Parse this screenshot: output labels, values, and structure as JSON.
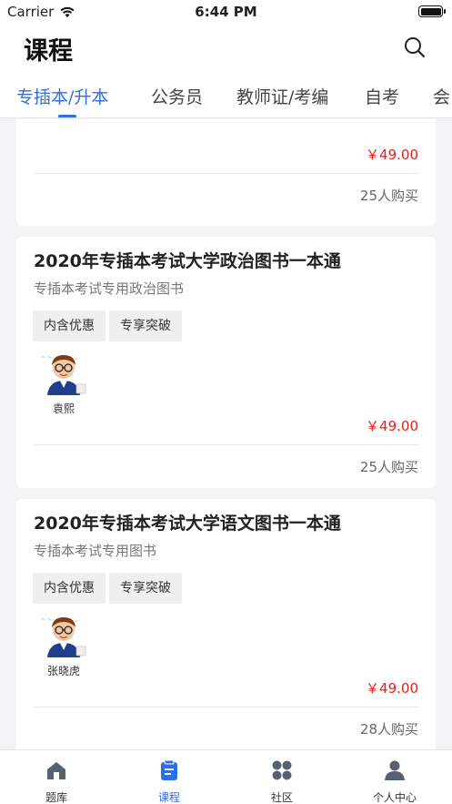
{
  "status_bar": {
    "carrier": "Carrier",
    "time": "6:44 PM"
  },
  "header": {
    "title": "课程"
  },
  "tabs": [
    {
      "label": "专插本/升本",
      "active": true
    },
    {
      "label": "公务员",
      "active": false
    },
    {
      "label": "教师证/考编",
      "active": false
    },
    {
      "label": "自考",
      "active": false
    },
    {
      "label": "会",
      "active": false
    }
  ],
  "courses": [
    {
      "price": "￥49.00",
      "buyers": "25人购买"
    },
    {
      "title": "2020年专插本考试大学政治图书一本通",
      "subtitle": "专插本考试专用政治图书",
      "tags": [
        "内含优惠",
        "专享突破"
      ],
      "teacher": "袁熙",
      "price": "￥49.00",
      "buyers": "25人购买"
    },
    {
      "title": "2020年专插本考试大学语文图书一本通",
      "subtitle": "专插本考试专用图书",
      "tags": [
        "内含优惠",
        "专享突破"
      ],
      "teacher": "张晓虎",
      "price": "￥49.00",
      "buyers": "28人购买"
    }
  ],
  "tabbar": [
    {
      "label": "题库",
      "icon": "home-icon",
      "active": false
    },
    {
      "label": "课程",
      "icon": "clipboard-icon",
      "active": true
    },
    {
      "label": "社区",
      "icon": "grid-icon",
      "active": false
    },
    {
      "label": "个人中心",
      "icon": "person-icon",
      "active": false
    }
  ],
  "colors": {
    "accent": "#2f6fe4",
    "price": "#e0221b"
  }
}
